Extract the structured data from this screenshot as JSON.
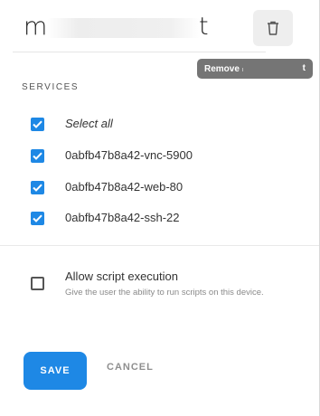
{
  "dialog": {
    "title_start": "m",
    "title_end": "t",
    "delete_icon": "trash-icon"
  },
  "tooltip": {
    "text": "Remove",
    "tail": "t"
  },
  "services": {
    "section_label": "SERVICES",
    "select_all_label": "Select all",
    "items": [
      {
        "label": "0abfb47b8a42-vnc-5900",
        "checked": true
      },
      {
        "label": "0abfb47b8a42-web-80",
        "checked": true
      },
      {
        "label": "0abfb47b8a42-ssh-22",
        "checked": true
      }
    ]
  },
  "permissions": {
    "script_execution_label": "Allow script execution",
    "script_execution_description": "Give the user the ability to run scripts on this device.",
    "script_execution_checked": false
  },
  "actions": {
    "save_label": "SAVE",
    "cancel_label": "CANCEL"
  },
  "colors": {
    "accent": "#1e88e5",
    "tooltip_bg": "#757575"
  }
}
